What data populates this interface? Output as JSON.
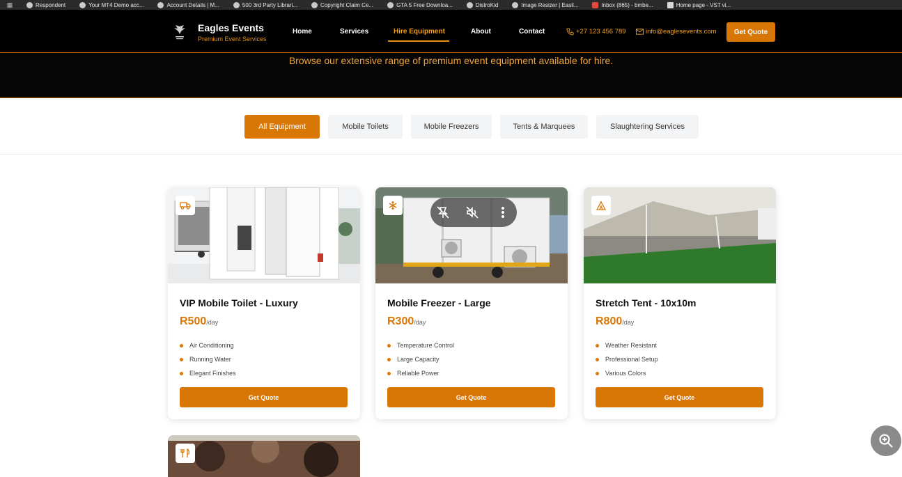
{
  "bookmarks": [
    {
      "label": "Respondent"
    },
    {
      "label": "Your MT4 Demo acc..."
    },
    {
      "label": "Account Details | M..."
    },
    {
      "label": "500 3rd Party Librari..."
    },
    {
      "label": "Copyright Claim Ce..."
    },
    {
      "label": "GTA 5 Free Downloa..."
    },
    {
      "label": "DistroKid"
    },
    {
      "label": "Image Resizer | Easil..."
    },
    {
      "label": "Inbox (865) - bmbe..."
    },
    {
      "label": "Home page - VST vi..."
    }
  ],
  "brand": {
    "name": "Eagles Events",
    "tagline": "Premium Event Services",
    "logo_text": "EAGLE EVENTS"
  },
  "nav": {
    "links": [
      "Home",
      "Services",
      "Hire Equipment",
      "About",
      "Contact"
    ],
    "active": "Hire Equipment",
    "phone": "+27 123 456 789",
    "email": "info@eaglesevents.com",
    "cta": "Get Quote"
  },
  "hero": {
    "subtitle": "Browse our extensive range of premium event equipment available for hire."
  },
  "filters": [
    "All Equipment",
    "Mobile Toilets",
    "Mobile Freezers",
    "Tents & Marquees",
    "Slaughtering Services"
  ],
  "filters_active": "All Equipment",
  "cards": [
    {
      "title": "VIP Mobile Toilet - Luxury",
      "price": "R500",
      "per": "/day",
      "icon": "truck-icon",
      "features": [
        "Air Conditioning",
        "Running Water",
        "Elegant Finishes"
      ],
      "button": "Get Quote"
    },
    {
      "title": "Mobile Freezer - Large",
      "price": "R300",
      "per": "/day",
      "icon": "snowflake-icon",
      "features": [
        "Temperature Control",
        "Large Capacity",
        "Reliable Power"
      ],
      "button": "Get Quote"
    },
    {
      "title": "Stretch Tent - 10x10m",
      "price": "R800",
      "per": "/day",
      "icon": "tent-icon",
      "features": [
        "Weather Resistant",
        "Professional Setup",
        "Various Colors"
      ],
      "button": "Get Quote"
    }
  ],
  "card4": {
    "icon": "utensils-icon"
  },
  "colors": {
    "accent": "#d97706",
    "nav_bg": "#000000"
  }
}
